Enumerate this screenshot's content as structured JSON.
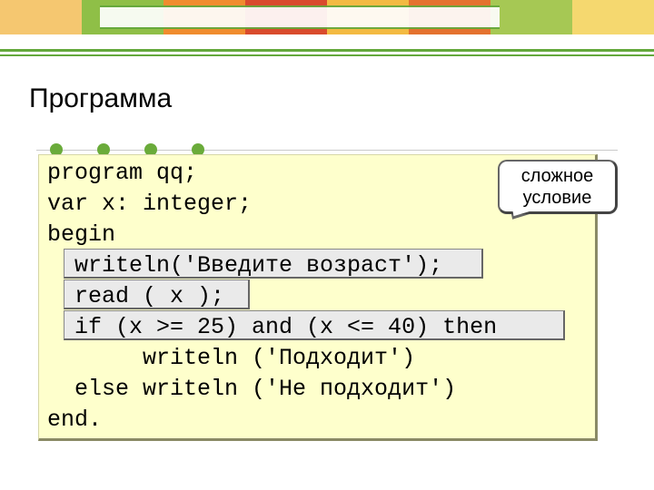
{
  "title": "Программа",
  "callout": {
    "line1": "сложное",
    "line2": "условие"
  },
  "code": {
    "l1": "program qq;",
    "l2": "var x: integer;",
    "l3": "begin",
    "l4": "  writeln('Введите возраст');",
    "l5": "  read ( x );",
    "l6": "  if (x >= 25) and (x <= 40) then",
    "l7": "       writeln ('Подходит')",
    "l8": "  else writeln ('Не подходит')",
    "l9": "end."
  }
}
